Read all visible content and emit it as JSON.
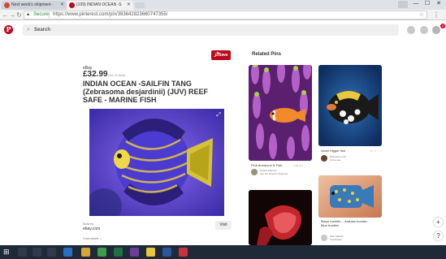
{
  "browser": {
    "tabs": [
      {
        "label": "Next week's shipment -"
      },
      {
        "label": "(109) INDIAN OCEAN -S"
      }
    ],
    "window_controls": {
      "minimize": "—",
      "maximize": "☐",
      "close": "✕"
    },
    "address": {
      "secure_label": "Secure",
      "url": "https://www.pinterest.com/pin/393642823660747355/"
    }
  },
  "pinterest_header": {
    "logo": "P",
    "search_placeholder": "Search",
    "notification_count": "2"
  },
  "pin": {
    "save_label": "Save",
    "source": "eBay",
    "price": "£32.99",
    "stock": "Out of stock",
    "title": "INDIAN OCEAN -SAILFIN TANG (Zebrasoma desjardinii) (JUV) REEF SAFE - MARINE FISH",
    "sold_by_label": "Sold by",
    "sold_by_source": "ebay.com",
    "visit_label": "Visit",
    "comments_label": "Comments ⌄"
  },
  "related": {
    "heading": "Related Pins",
    "items": [
      {
        "title": "Pink Anemone & Fish",
        "meta": "1.8k  ⚲ 3",
        "pinner": "Debbie Marcus",
        "board": "Into the Ocean's Splendor"
      },
      {
        "title": "clown trigger fish",
        "meta": "5  ♡ 1",
        "pinner": "Pinterest Lover",
        "board": "In the sea"
      },
      {
        "title": "",
        "meta": "",
        "pinner": "",
        "board": ""
      },
      {
        "title": "Blaue trunkfis… Arabian boxfish. Blue boxfish",
        "meta": "",
        "pinner": "Sam Mattern",
        "board": "Freshwater"
      }
    ]
  },
  "colors": {
    "brand_red": "#bd081c",
    "secure_green": "#1a8a34",
    "taskbar": "#1f2a38"
  }
}
